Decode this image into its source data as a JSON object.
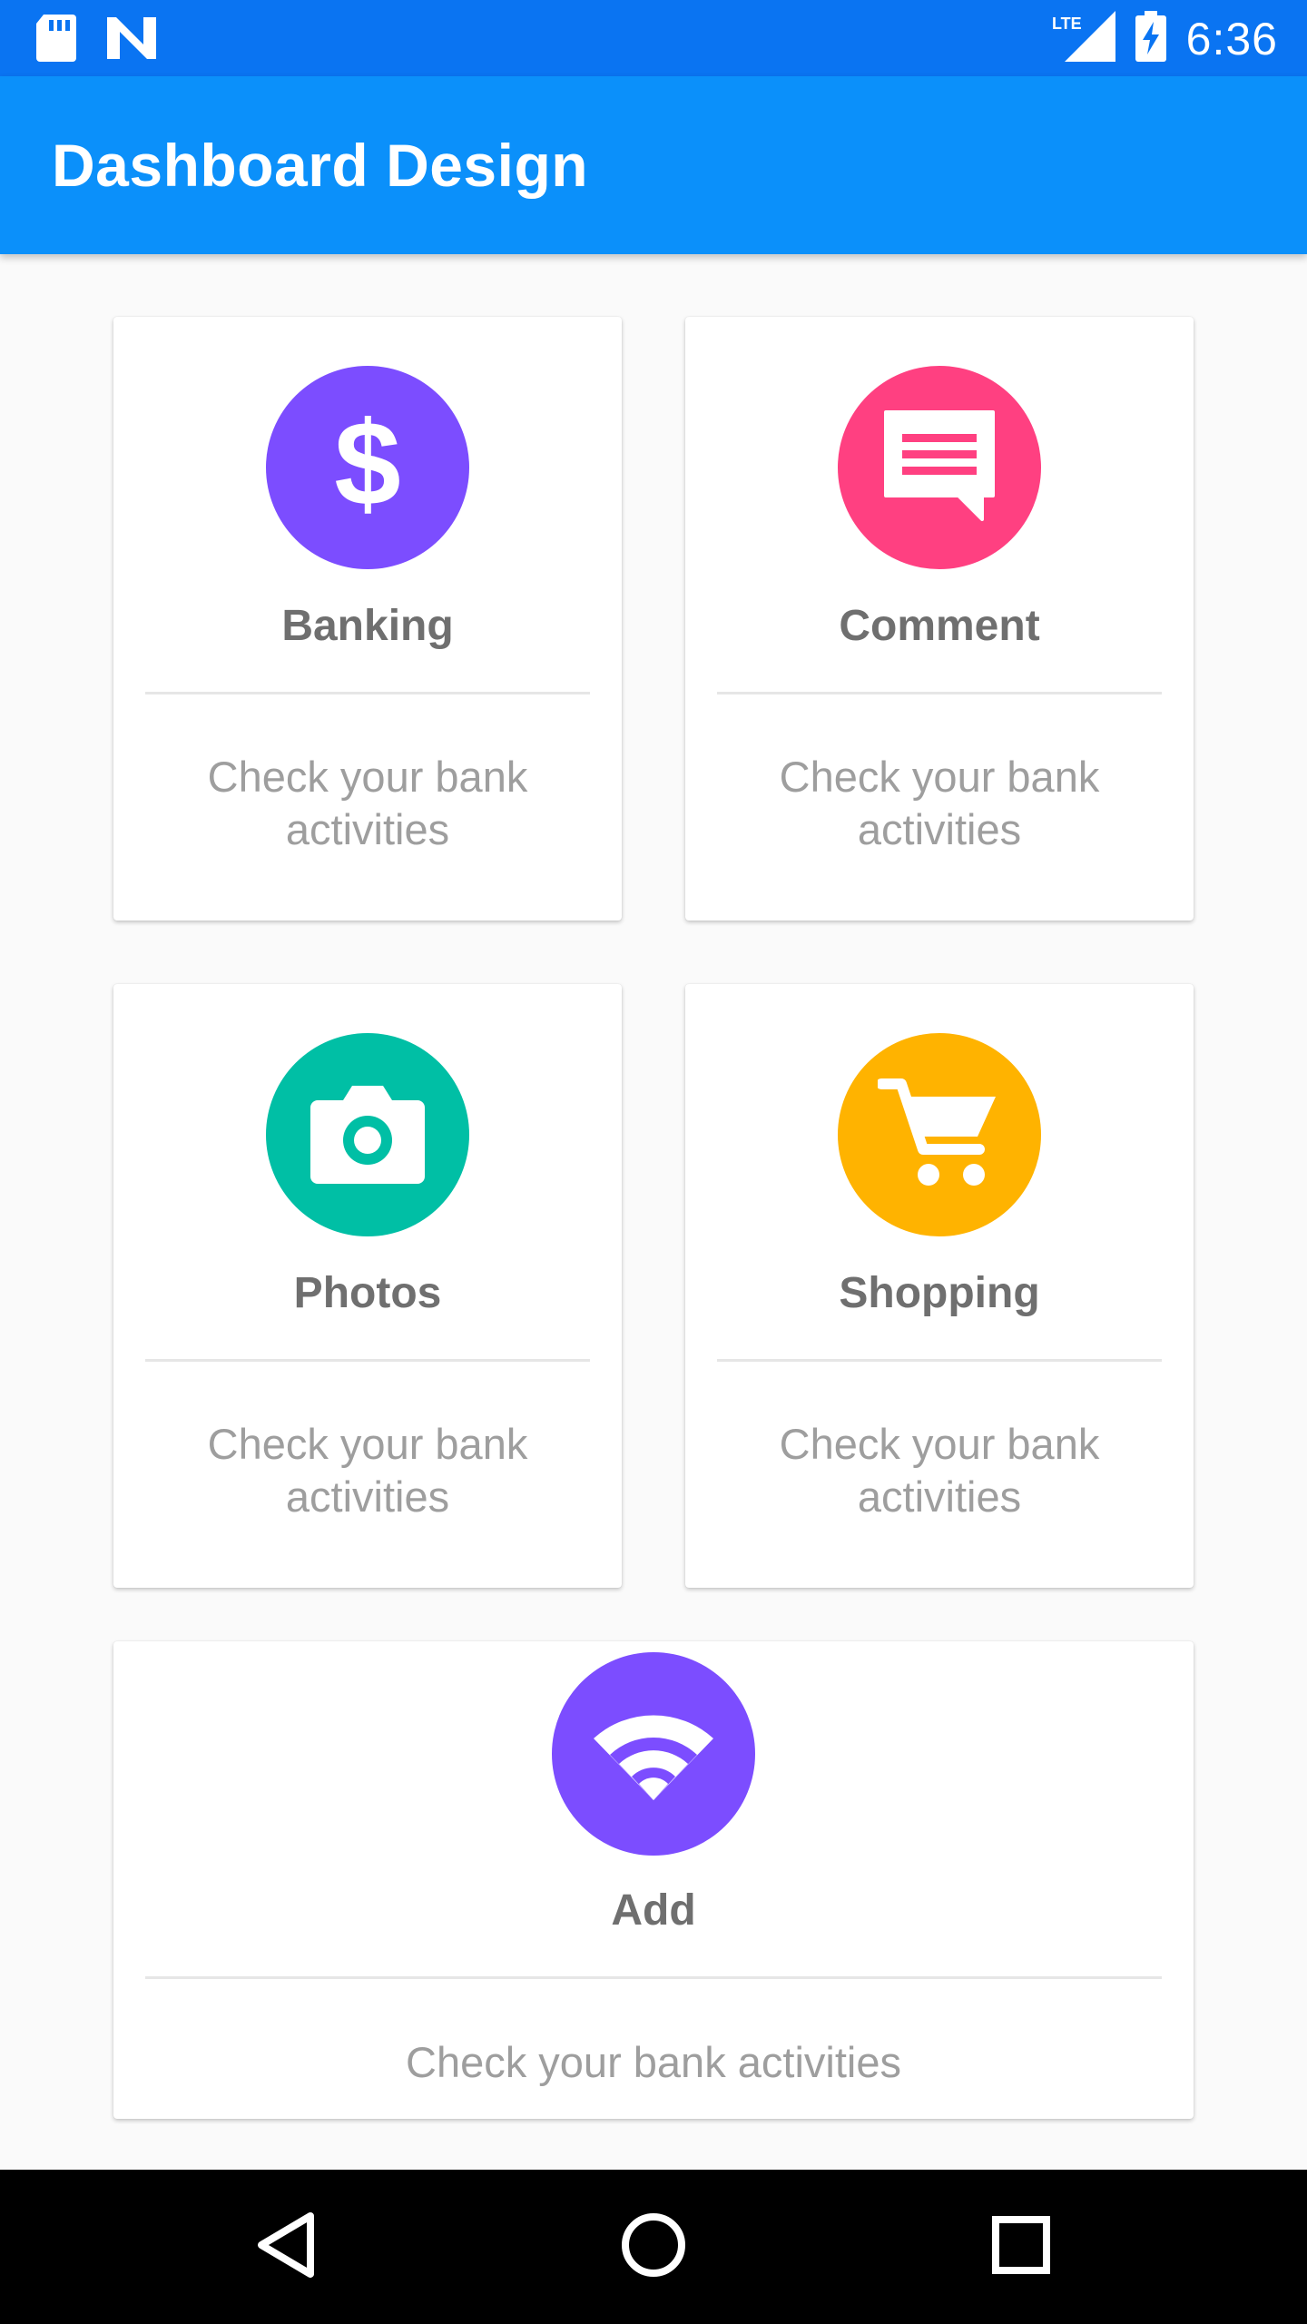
{
  "status_bar": {
    "time": "6:36",
    "network": "LTE",
    "icons": [
      "sd-card-icon",
      "n-icon",
      "lte-signal-icon",
      "battery-charging-icon"
    ]
  },
  "app_bar": {
    "title": "Dashboard Design"
  },
  "cards": [
    {
      "title": "Banking",
      "desc_line1": "Check your bank",
      "desc_line2": "activities",
      "icon": "dollar-icon",
      "color": "#7c4dff"
    },
    {
      "title": "Comment",
      "desc_line1": "Check your bank",
      "desc_line2": "activities",
      "icon": "comment-icon",
      "color": "#ff4081"
    },
    {
      "title": "Photos",
      "desc_line1": "Check your bank",
      "desc_line2": "activities",
      "icon": "camera-icon",
      "color": "#00bfa5"
    },
    {
      "title": "Shopping",
      "desc_line1": "Check your bank",
      "desc_line2": "activities",
      "icon": "cart-icon",
      "color": "#ffb300"
    },
    {
      "title": "Add",
      "desc": "Check your bank activities",
      "icon": "wifi-icon",
      "color": "#7c4dff"
    }
  ],
  "nav_bar": {
    "buttons": [
      "back-icon",
      "home-icon",
      "recents-icon"
    ]
  }
}
